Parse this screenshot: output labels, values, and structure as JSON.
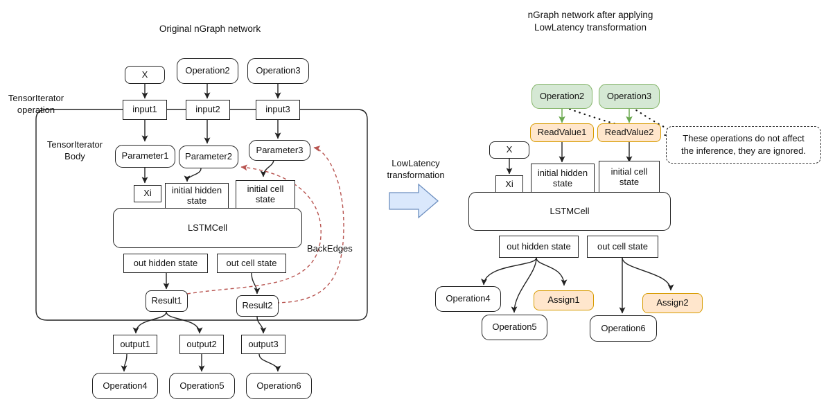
{
  "titles": {
    "left": "Original nGraph network",
    "right": "nGraph network after applying\nLowLatency transformation"
  },
  "arrow_label": "LowLatency\ntransformation",
  "colors": {
    "green_fill": "#d5e8d4",
    "green_stroke": "#82b366",
    "orange_fill": "#ffe6cc",
    "orange_stroke": "#d79b00",
    "backedge_stroke": "#b85450",
    "arrow_fill": "#dae8fc",
    "arrow_stroke": "#6c8ebf",
    "node_stroke": "#222222"
  },
  "left": {
    "outer_label": "TensorIterator\noperation",
    "body_label": "TensorIterator\nBody",
    "backedges_label": "BackEdges",
    "x": "X",
    "operation2": "Operation2",
    "operation3": "Operation3",
    "input1": "input1",
    "input2": "input2",
    "input3": "input3",
    "parameter1": "Parameter1",
    "parameter2": "Parameter2",
    "parameter3": "Parameter3",
    "xi": "Xi",
    "initial_hidden_state": "initial hidden\nstate",
    "initial_cell_state": "initial cell\nstate",
    "lstmcell": "LSTMCell",
    "out_hidden_state": "out hidden state",
    "out_cell_state": "out cell state",
    "result1": "Result1",
    "result2": "Result2",
    "output1": "output1",
    "output2": "output2",
    "output3": "output3",
    "operation4": "Operation4",
    "operation5": "Operation5",
    "operation6": "Operation6"
  },
  "right": {
    "operation2": "Operation2",
    "operation3": "Operation3",
    "readvalue1": "ReadValue1",
    "readvalue2": "ReadValue2",
    "note": "These operations do not affect\nthe inference, they are ignored.",
    "x": "X",
    "xi": "Xi",
    "initial_hidden_state": "initial hidden\nstate",
    "initial_cell_state": "initial cell\nstate",
    "lstmcell": "LSTMCell",
    "out_hidden_state": "out hidden state",
    "out_cell_state": "out cell state",
    "operation4": "Operation4",
    "operation5": "Operation5",
    "assign1": "Assign1",
    "assign2": "Assign2",
    "operation6": "Operation6"
  }
}
